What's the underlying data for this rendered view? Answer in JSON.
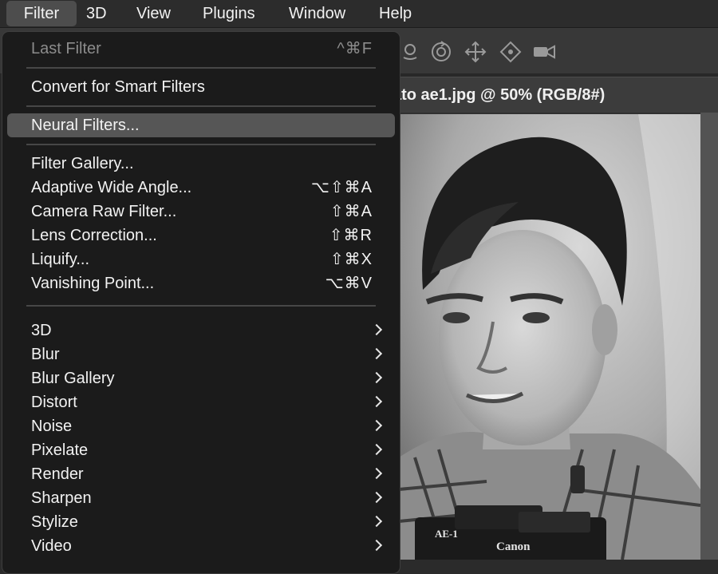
{
  "menubar": {
    "items": [
      {
        "label": "Filter",
        "active": true
      },
      {
        "label": "3D"
      },
      {
        "label": "View"
      },
      {
        "label": "Plugins"
      },
      {
        "label": "Window"
      },
      {
        "label": "Help"
      }
    ]
  },
  "toolbar": {
    "icons": [
      "rotate-3d-icon",
      "roll-3d-icon",
      "pan-3d-icon",
      "slide-3d-icon",
      "scale-3d-video-icon"
    ]
  },
  "document": {
    "tab_title": "ato ae1.jpg @ 50% (RGB/8#)"
  },
  "filter_menu": {
    "last_filter": {
      "label": "Last Filter",
      "shortcut": "^⌘F"
    },
    "convert_smart": {
      "label": "Convert for Smart Filters"
    },
    "neural_filters": {
      "label": "Neural Filters..."
    },
    "filter_gallery": {
      "label": "Filter Gallery..."
    },
    "adaptive_wide_angle": {
      "label": "Adaptive Wide Angle...",
      "shortcut": "⌥⇧⌘A"
    },
    "camera_raw": {
      "label": "Camera Raw Filter...",
      "shortcut": "⇧⌘A"
    },
    "lens_correction": {
      "label": "Lens Correction...",
      "shortcut": "⇧⌘R"
    },
    "liquify": {
      "label": "Liquify...",
      "shortcut": "⇧⌘X"
    },
    "vanishing_point": {
      "label": "Vanishing Point...",
      "shortcut": "⌥⌘V"
    },
    "submenus": [
      {
        "label": "3D"
      },
      {
        "label": "Blur"
      },
      {
        "label": "Blur Gallery"
      },
      {
        "label": "Distort"
      },
      {
        "label": "Noise"
      },
      {
        "label": "Pixelate"
      },
      {
        "label": "Render"
      },
      {
        "label": "Sharpen"
      },
      {
        "label": "Stylize"
      },
      {
        "label": "Video"
      }
    ]
  },
  "photo": {
    "camera_brand": "Canon",
    "camera_model": "AE-1"
  }
}
